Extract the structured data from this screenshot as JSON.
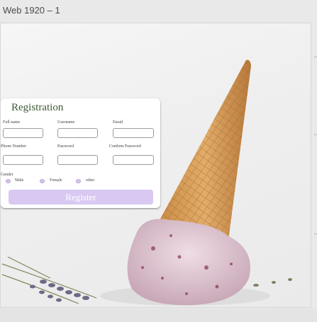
{
  "artboard": {
    "title": "Web 1920 – 1"
  },
  "form": {
    "title": "Registration",
    "labels": {
      "full_name": "Full name",
      "username": "Username",
      "email": "Email",
      "phone": "Phone Number",
      "password": "Password",
      "confirm_password": "Confirm Password",
      "gender": "Gender"
    },
    "gender_options": [
      "Male",
      "Female",
      "other"
    ],
    "register_label": "Register"
  },
  "colors": {
    "title_green": "#3c5a35",
    "button_lavender": "#d9c9f2",
    "radio_lavender": "#d6c6ec"
  }
}
